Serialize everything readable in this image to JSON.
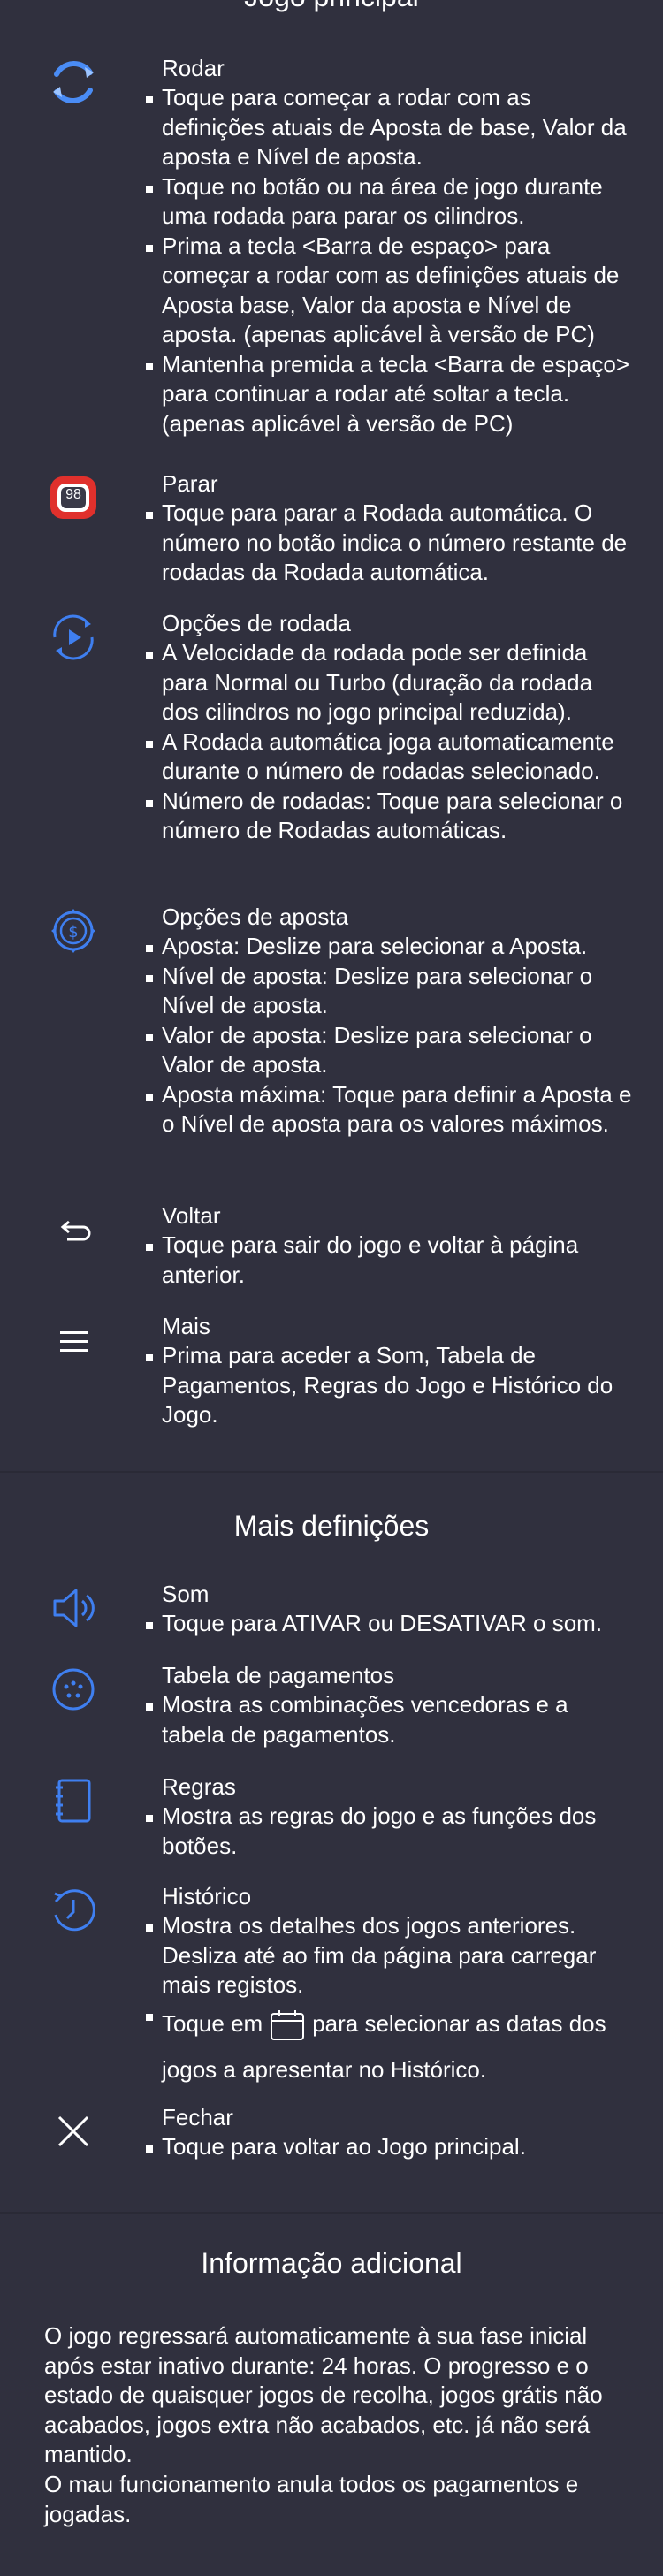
{
  "main": {
    "title": "Jogo principal",
    "spin": {
      "icon": "spin-icon",
      "label": "Rodar",
      "items": [
        "Toque para começar a rodar com as definições atuais de Aposta de base, Valor da aposta e Nível de aposta.",
        "Toque no botão ou na área de jogo durante uma rodada para parar os cilindros.",
        "Prima a tecla <Barra de espaço> para começar a rodar com as definições atuais de Aposta base, Valor da aposta e Nível de aposta. (apenas aplicável à versão de PC)",
        "Mantenha premida a tecla <Barra de espaço> para continuar a rodar até soltar a tecla. (apenas aplicável à versão de PC)"
      ]
    },
    "stop": {
      "icon": "stop-autospin-icon",
      "badge": "98",
      "label": "Parar",
      "items": [
        "Toque para parar a Rodada automática. O número no botão indica o número restante de rodadas da Rodada automática."
      ]
    },
    "spin_options": {
      "icon": "spin-options-icon",
      "label": "Opções de rodada",
      "items": [
        "A Velocidade da rodada pode ser definida para Normal ou Turbo (duração da rodada dos cilindros no jogo principal reduzida).",
        "A Rodada automática joga automaticamente durante o número de rodadas selecionado.",
        "Número de rodadas: Toque para selecionar o número de Rodadas automáticas."
      ]
    },
    "bet_options": {
      "icon": "bet-options-icon",
      "label": "Opções de aposta",
      "items": [
        "Aposta: Deslize para selecionar a Aposta.",
        "Nível de aposta: Deslize para selecionar o Nível de aposta.",
        "Valor de aposta: Deslize para selecionar o Valor de aposta.",
        "Aposta máxima: Toque para definir a Aposta e o Nível de aposta para os valores máximos."
      ]
    },
    "back": {
      "icon": "back-arrow-icon",
      "label": "Voltar",
      "items": [
        "Toque para sair do jogo e voltar à página anterior."
      ]
    },
    "more": {
      "icon": "menu-icon",
      "label": "Mais",
      "items": [
        "Prima para aceder a Som, Tabela de Pagamentos, Regras do Jogo e Histórico do Jogo."
      ]
    }
  },
  "more_settings": {
    "title": "Mais definições",
    "sound": {
      "icon": "sound-icon",
      "label": "Som",
      "items": [
        "Toque para ATIVAR ou DESATIVAR o som."
      ]
    },
    "paytable": {
      "icon": "paytable-icon",
      "label": "Tabela de pagamentos",
      "items": [
        "Mostra as combinações vencedoras e a tabela de pagamentos."
      ]
    },
    "rules": {
      "icon": "rules-icon",
      "label": "Regras",
      "items": [
        "Mostra as regras do jogo e as funções dos botões."
      ]
    },
    "history": {
      "icon": "history-icon",
      "label": "Histórico",
      "items": [
        "Mostra os detalhes dos jogos anteriores. Desliza até ao fim da página para carregar mais registos."
      ],
      "calendar_before": "Toque em",
      "calendar_after": "para selecionar as datas dos jogos a apresentar no Histórico.",
      "calendar_icon": "calendar-icon"
    },
    "close": {
      "icon": "close-icon",
      "label": "Fechar",
      "items": [
        "Toque para voltar ao Jogo principal."
      ]
    }
  },
  "additional_info": {
    "title": "Informação adicional",
    "paragraphs": [
      "O jogo regressará automaticamente à sua fase inicial após estar inativo durante: 24 horas. O progresso e o estado de quaisquer jogos de recolha, jogos grátis não acabados, jogos extra não acabados, etc. já não será mantido.",
      "O mau funcionamento anula todos os pagamentos e jogadas."
    ]
  },
  "colors": {
    "background": "#30303e",
    "icon_blue": "#3f7ff0",
    "stop_red": "#e0302c",
    "text": "#ffffff"
  }
}
